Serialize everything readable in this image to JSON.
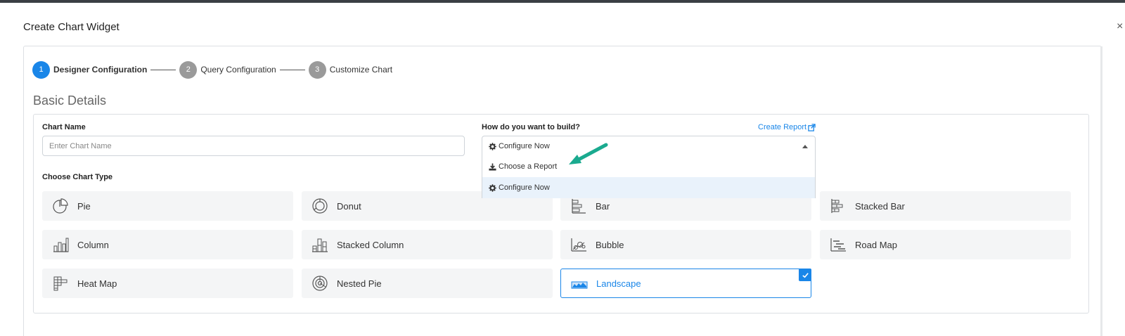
{
  "modal": {
    "title": "Create Chart Widget",
    "close_label": "×"
  },
  "stepper": {
    "steps": [
      {
        "number": "1",
        "label": "Designer Configuration",
        "active": true
      },
      {
        "number": "2",
        "label": "Query Configuration",
        "active": false
      },
      {
        "number": "3",
        "label": "Customize Chart",
        "active": false
      }
    ]
  },
  "basic_details": {
    "title": "Basic Details",
    "chart_name_label": "Chart Name",
    "chart_name_placeholder": "Enter Chart Name",
    "chart_name_value": "",
    "build_label": "How do you want to build?",
    "create_report_link": "Create Report",
    "build_select_value": "Configure Now",
    "build_options": [
      {
        "label": "Choose a Report",
        "icon": "download-icon"
      },
      {
        "label": "Configure Now",
        "icon": "gear-icon",
        "selected": true
      }
    ],
    "chart_type_label": "Choose Chart Type"
  },
  "chart_types": [
    {
      "label": "Pie",
      "icon": "pie-chart-icon"
    },
    {
      "label": "Donut",
      "icon": "donut-chart-icon"
    },
    {
      "label": "Bar",
      "icon": "bar-chart-icon"
    },
    {
      "label": "Stacked Bar",
      "icon": "stacked-bar-chart-icon"
    },
    {
      "label": "Column",
      "icon": "column-chart-icon"
    },
    {
      "label": "Stacked Column",
      "icon": "stacked-column-chart-icon"
    },
    {
      "label": "Bubble",
      "icon": "bubble-chart-icon"
    },
    {
      "label": "Road Map",
      "icon": "road-map-chart-icon"
    },
    {
      "label": "Heat Map",
      "icon": "heat-map-chart-icon"
    },
    {
      "label": "Nested Pie",
      "icon": "nested-pie-chart-icon"
    },
    {
      "label": "Landscape",
      "icon": "landscape-chart-icon",
      "selected": true
    }
  ],
  "colors": {
    "accent": "#1a86e8",
    "step_inactive": "#9a9a9a",
    "card_bg": "#f4f5f6",
    "annotation_arrow": "#1aaa8f"
  }
}
